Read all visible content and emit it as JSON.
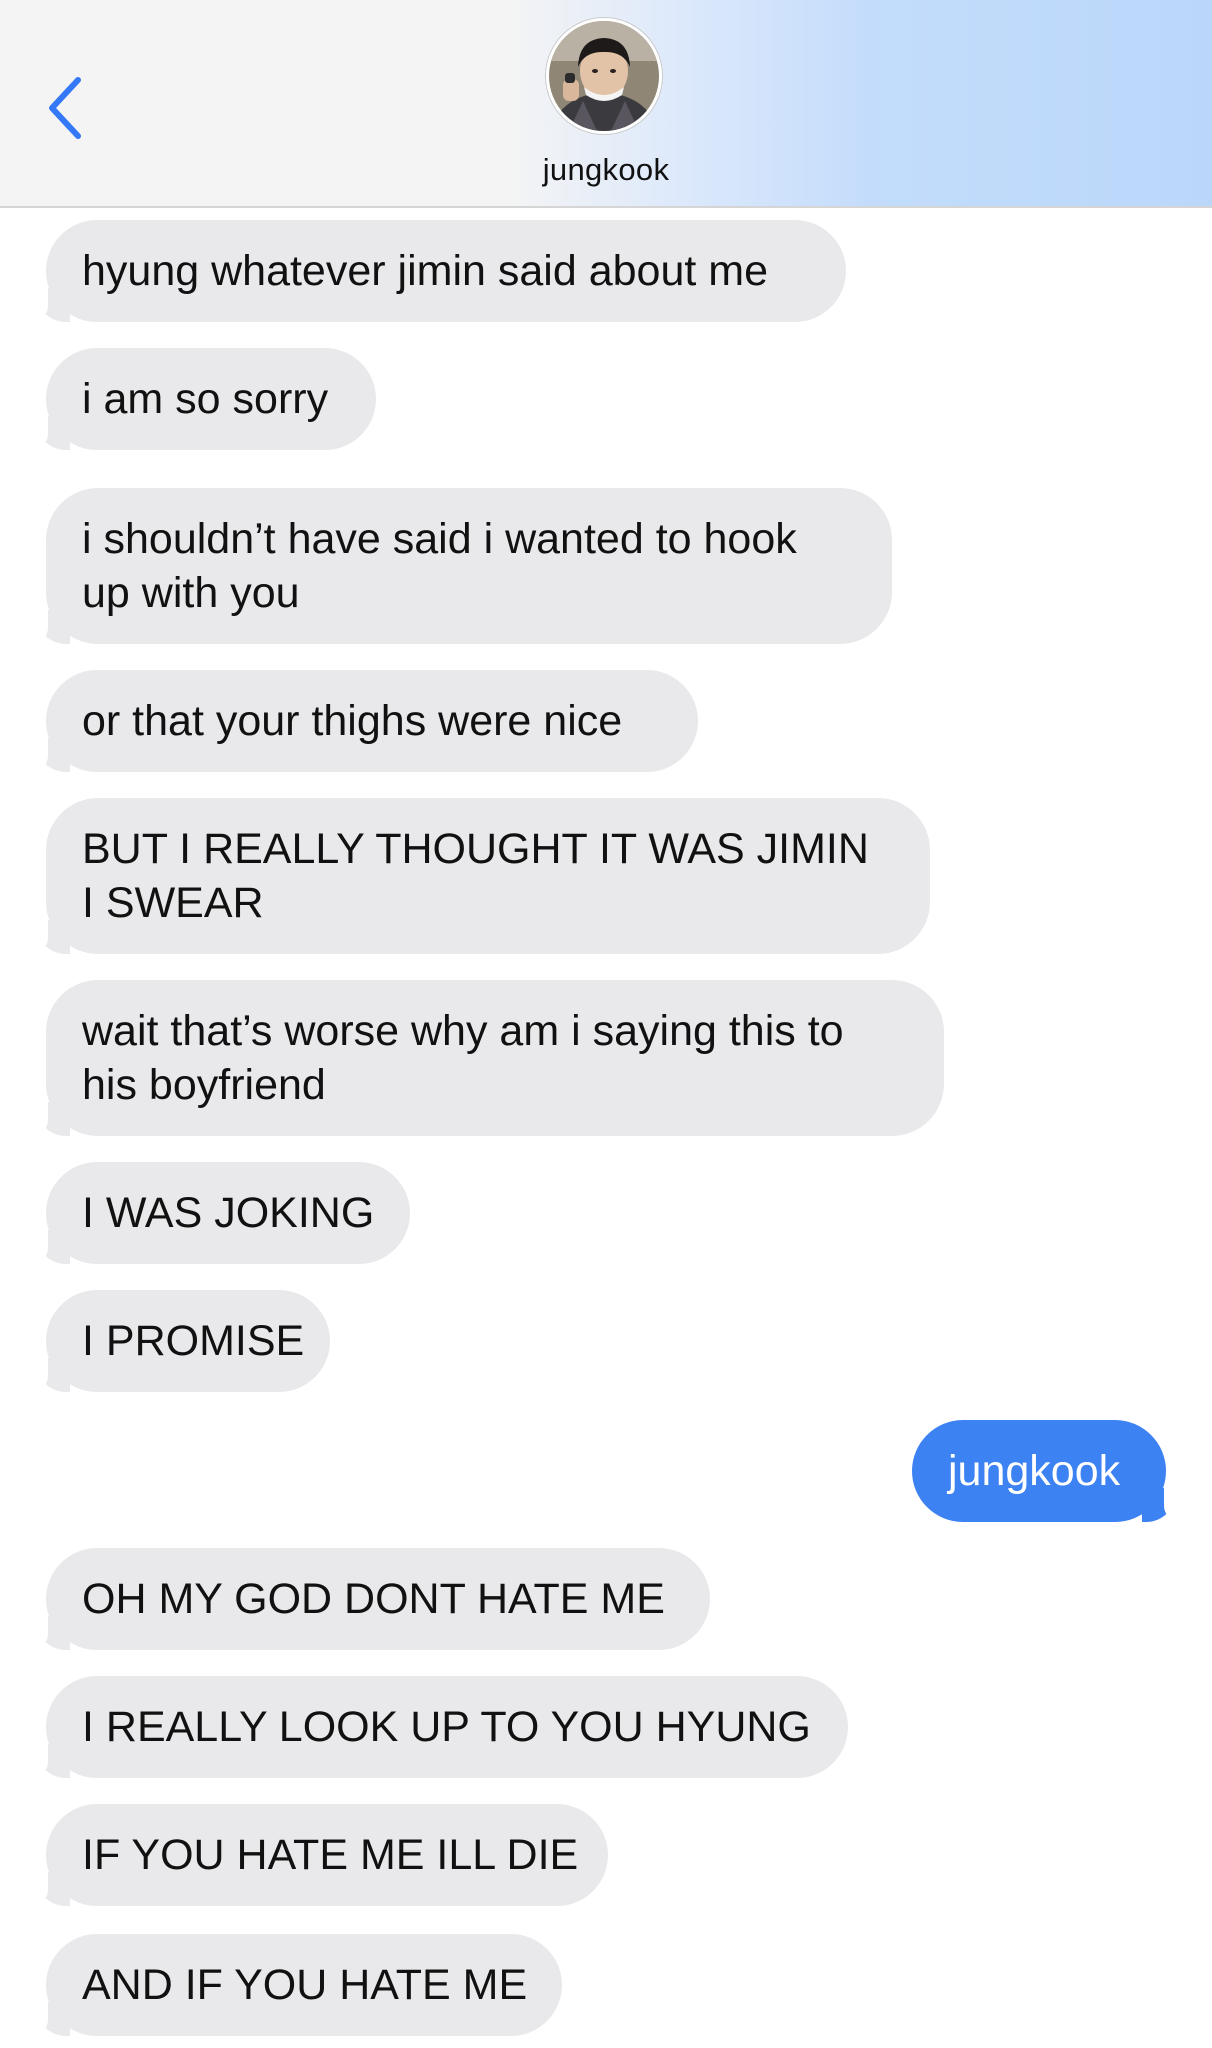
{
  "header": {
    "contact_name": "jungkook",
    "back_icon": "chevron-left-icon",
    "accent_color": "#3478f6"
  },
  "messages": [
    {
      "side": "in",
      "lines": [
        "hyung whatever jimin said about me"
      ]
    },
    {
      "side": "in",
      "lines": [
        "i am so sorry"
      ]
    },
    {
      "side": "in",
      "lines": [
        "i shouldn’t have said i wanted to hook",
        "up with you"
      ]
    },
    {
      "side": "in",
      "lines": [
        "or that your thighs were nice"
      ]
    },
    {
      "side": "in",
      "lines": [
        "BUT I REALLY THOUGHT IT WAS JIMIN",
        "I SWEAR"
      ]
    },
    {
      "side": "in",
      "lines": [
        "wait that’s worse why am i saying this to",
        "his boyfriend"
      ]
    },
    {
      "side": "in",
      "lines": [
        "I WAS JOKING"
      ]
    },
    {
      "side": "in",
      "lines": [
        "I PROMISE"
      ]
    },
    {
      "side": "out",
      "lines": [
        "jungkook"
      ]
    },
    {
      "side": "in",
      "lines": [
        "OH MY GOD DONT HATE ME"
      ]
    },
    {
      "side": "in",
      "lines": [
        "I REALLY LOOK UP TO YOU HYUNG"
      ]
    },
    {
      "side": "in",
      "lines": [
        "IF YOU HATE ME ILL DIE"
      ]
    },
    {
      "side": "in",
      "lines": [
        "AND IF YOU HATE ME"
      ]
    }
  ],
  "colors": {
    "incoming_bubble": "#e9e9eb",
    "outgoing_bubble": "#3d82f3",
    "header_tint": "#bad7fa"
  }
}
